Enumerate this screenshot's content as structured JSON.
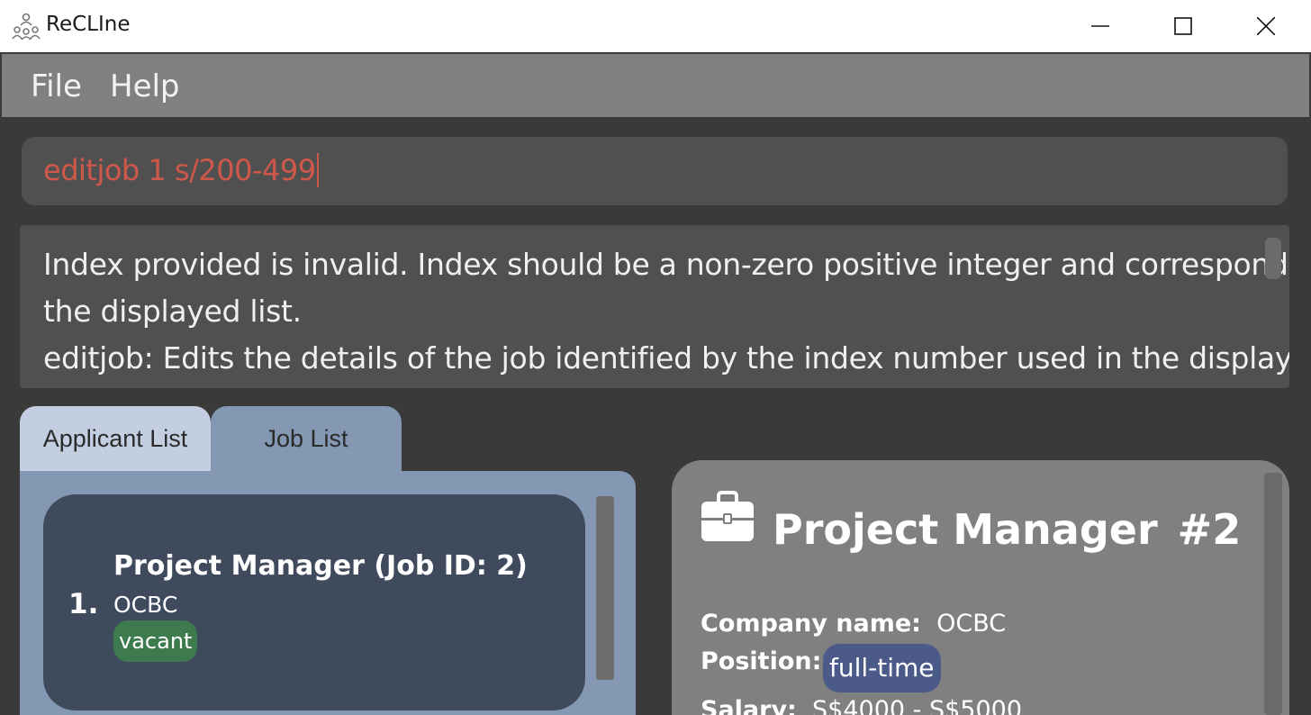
{
  "window": {
    "title": "ReCLIne",
    "icons": {
      "app": "people-network-icon",
      "minimize": "minimize-icon",
      "maximize": "maximize-icon",
      "close": "close-icon"
    }
  },
  "menu": {
    "file": "File",
    "help": "Help"
  },
  "command": {
    "value": "editjob 1 s/200-499",
    "text_color": "#d0584a"
  },
  "result": {
    "lines": [
      "Index provided is invalid. Index should be a non-zero positive integer and corresponds to",
      "the displayed list.",
      "editjob: Edits the details of the job identified by the index number used in the displayed Job"
    ]
  },
  "tabs": [
    {
      "label": "Applicant List",
      "selected": false
    },
    {
      "label": "Job List",
      "selected": true
    }
  ],
  "job_list": [
    {
      "index": "1.",
      "title": "Project Manager (Job ID: 2)",
      "company": "OCBC",
      "status": "vacant",
      "status_color": "#3d7a4e"
    }
  ],
  "detail": {
    "icon": "briefcase-icon",
    "title": "Project Manager",
    "id": "#2",
    "company_label": "Company name:",
    "company_value": "OCBC",
    "position_label": "Position:",
    "position_value": "full-time",
    "position_color": "#4c5a8a",
    "salary_label": "Salary:",
    "salary_value": "S$4000 - S$5000"
  }
}
